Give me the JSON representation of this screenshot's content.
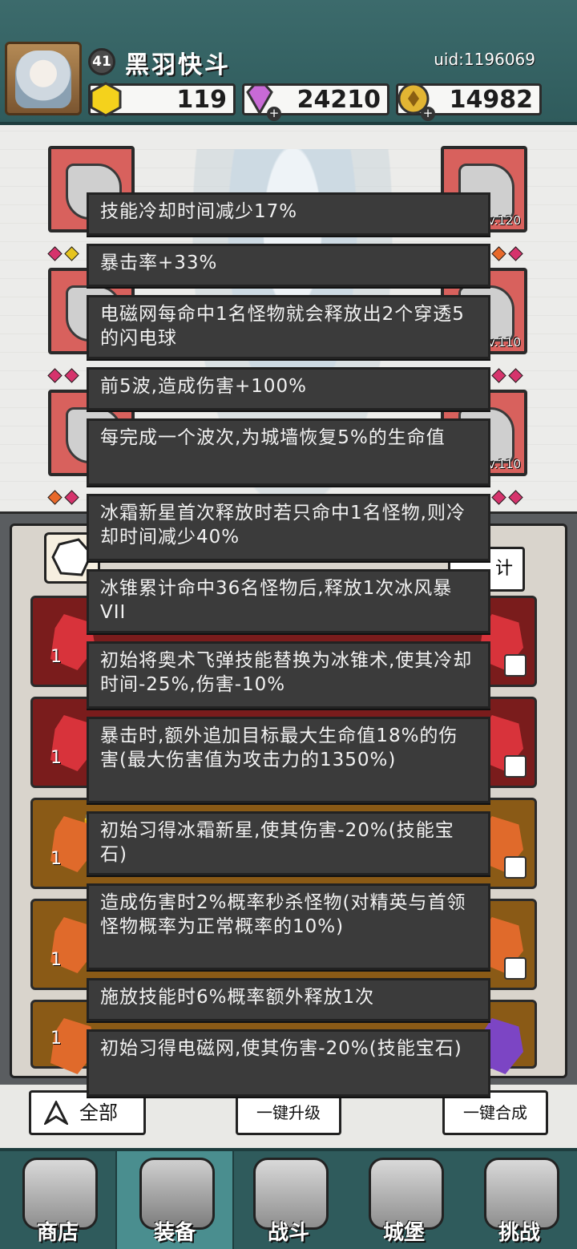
{
  "header": {
    "player_name": "黑羽快斗",
    "level": "41",
    "uid": "uid:1196069",
    "currencies": [
      {
        "name": "gold-gem",
        "value": "119",
        "color": "#f4d21c"
      },
      {
        "name": "diamond",
        "value": "24210",
        "color": "#c86ad6"
      },
      {
        "name": "coin",
        "value": "14982",
        "color": "#e2b533"
      }
    ]
  },
  "equipment": {
    "right_slots": [
      {
        "level": "Lv.120"
      },
      {
        "level": "Lv.110"
      },
      {
        "level": "Lv.110"
      }
    ]
  },
  "inventory": {
    "stats_button_label": "计",
    "counts": [
      "1",
      "1",
      "1",
      "1",
      "1"
    ]
  },
  "tooltip": {
    "lines": [
      "技能冷却时间减少17%",
      "暴击率+33%",
      "电磁网每命中1名怪物就会释放出2个穿透5的闪电球",
      "前5波,造成伤害+100%",
      "每完成一个波次,为城墙恢复5%的生命值",
      "冰霜新星首次释放时若只命中1名怪物,则冷却时间减少40%",
      "冰锥累计命中36名怪物后,释放1次冰风暴VII",
      "初始将奥术飞弹技能替换为冰锥术,使其冷却时间-25%,伤害-10%",
      "暴击时,额外追加目标最大生命值18%的伤害(最大伤害值为攻击力的1350%)",
      "初始习得冰霜新星,使其伤害-20%(技能宝石)",
      "造成伤害时2%概率秒杀怪物(对精英与首领怪物概率为正常概率的10%)",
      "施放技能时6%概率额外释放1次",
      "初始习得电磁网,使其伤害-20%(技能宝石)"
    ]
  },
  "actions": {
    "all_label": "全部",
    "upgrade_all_label": "一键升级",
    "merge_all_label": "一键合成"
  },
  "nav": {
    "items": [
      {
        "label": "商店"
      },
      {
        "label": "装备"
      },
      {
        "label": "战斗"
      },
      {
        "label": "城堡"
      },
      {
        "label": "挑战"
      }
    ],
    "active_index": 1
  }
}
